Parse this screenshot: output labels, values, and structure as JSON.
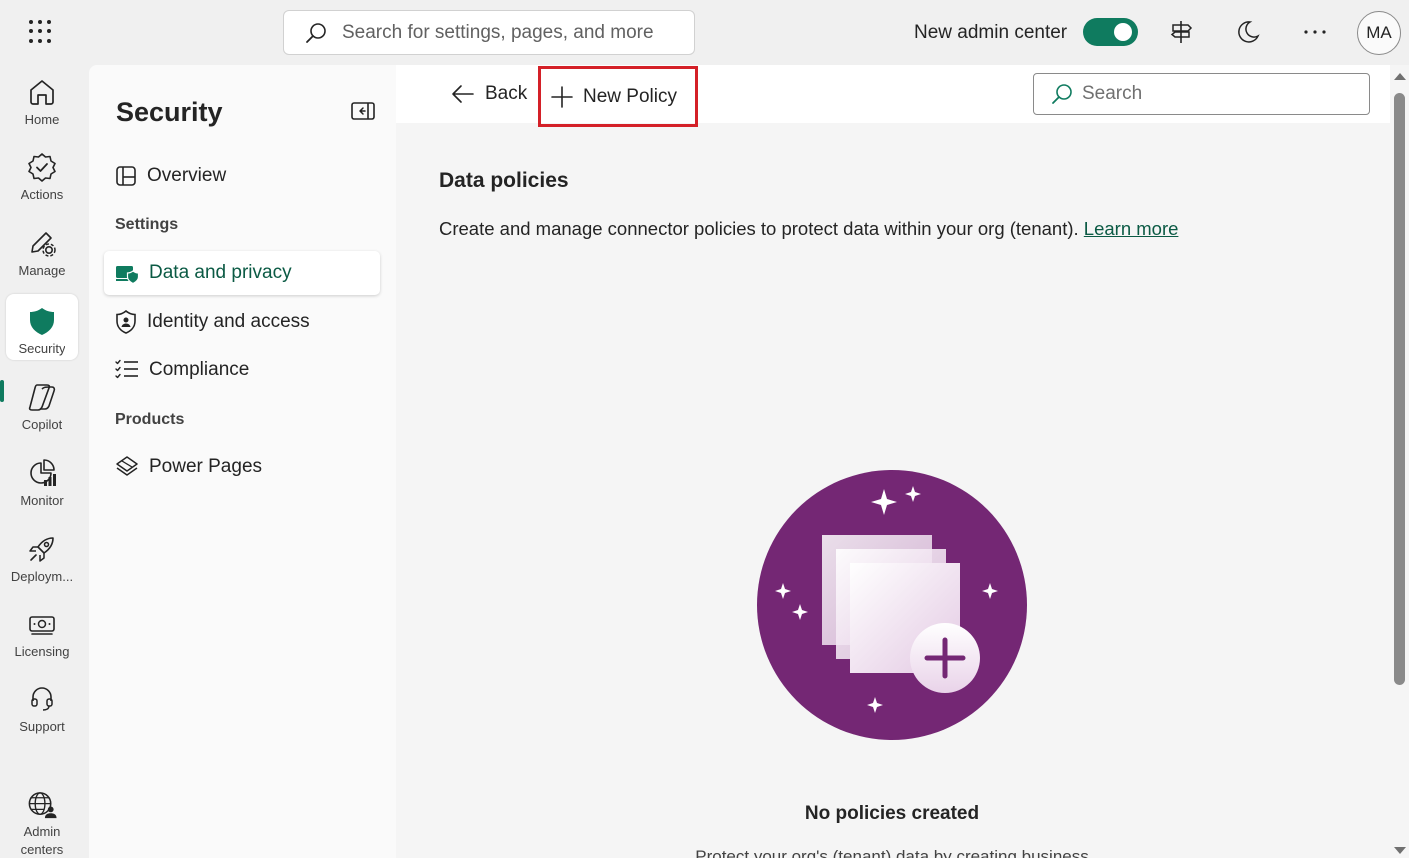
{
  "topbar": {
    "search_placeholder": "Search for settings, pages, and more",
    "admin_toggle_label": "New admin center",
    "admin_toggle_on": true,
    "avatar_initials": "MA",
    "icons": [
      "app-launcher-icon",
      "search-icon",
      "signpost-icon",
      "moon-icon",
      "more-icon"
    ]
  },
  "rail": {
    "items": [
      {
        "label": "Home",
        "icon": "home-icon"
      },
      {
        "label": "Actions",
        "icon": "actions-badge-icon"
      },
      {
        "label": "Manage",
        "icon": "manage-pen-gear-icon"
      },
      {
        "label": "Security",
        "icon": "shield-icon",
        "active": true
      },
      {
        "label": "Copilot",
        "icon": "copilot-icon"
      },
      {
        "label": "Monitor",
        "icon": "monitor-chart-icon"
      },
      {
        "label": "Deploym...",
        "icon": "rocket-icon"
      },
      {
        "label": "Licensing",
        "icon": "money-icon"
      },
      {
        "label": "Support",
        "icon": "headset-icon"
      },
      {
        "label": "Admin centers",
        "icon": "globe-person-icon"
      }
    ]
  },
  "panel": {
    "title": "Security",
    "overview": "Overview",
    "settings_header": "Settings",
    "data_privacy": "Data and privacy",
    "identity_access": "Identity and access",
    "compliance": "Compliance",
    "products_header": "Products",
    "power_pages": "Power Pages"
  },
  "main": {
    "back_label": "Back",
    "new_policy_label": "New Policy",
    "search_placeholder": "Search",
    "title": "Data policies",
    "description": "Create and manage connector policies to protect data within your org (tenant).",
    "learn_more": "Learn more",
    "empty_title": "No policies created",
    "empty_subtitle": "Protect your org's (tenant) data by creating business"
  },
  "colors": {
    "accent": "#0f7b5f",
    "highlight_border": "#d42028",
    "illustration_purple": "#742774"
  }
}
